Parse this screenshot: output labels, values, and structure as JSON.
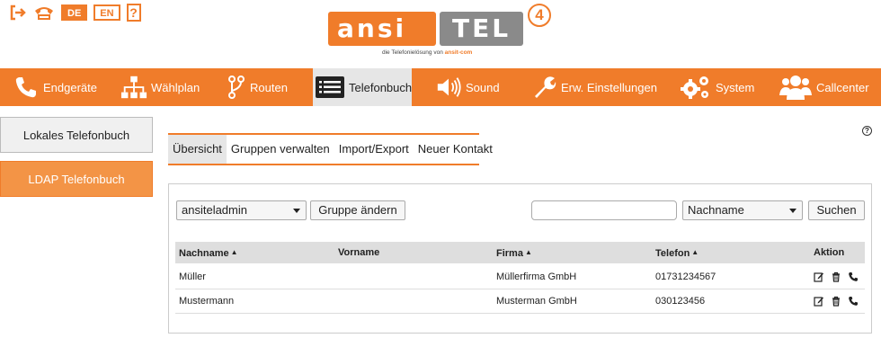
{
  "top_bar": {
    "logout_icon": "logout-icon",
    "phone_icon": "phone-hangup-icon",
    "lang_de": "DE",
    "lang_en": "EN",
    "help": "?"
  },
  "logo": {
    "part1": "ansi",
    "part2": "TEL",
    "version": "4",
    "tagline": "die Telefonielösung von",
    "tagline_brand": "ansit-com"
  },
  "main_nav": [
    {
      "label": "Endgeräte",
      "icon": "phone-icon"
    },
    {
      "label": "Wählplan",
      "icon": "sitemap-icon"
    },
    {
      "label": "Routen",
      "icon": "route-icon"
    },
    {
      "label": "Telefonbuch",
      "icon": "list-icon",
      "active": true
    },
    {
      "label": "Sound",
      "icon": "speaker-icon"
    },
    {
      "label": "Erw. Einstellungen",
      "icon": "wrench-icon"
    },
    {
      "label": "System",
      "icon": "gears-icon"
    },
    {
      "label": "Callcenter",
      "icon": "users-icon"
    }
  ],
  "sidebar": {
    "local": "Lokales Telefonbuch",
    "ldap": "LDAP Telefonbuch"
  },
  "sub_tabs": [
    "Übersicht",
    "Gruppen verwalten",
    "Import/Export",
    "Neuer Kontakt"
  ],
  "toolbar": {
    "group_select": "ansiteladmin",
    "group_button": "Gruppe ändern",
    "search_value": "",
    "search_field_select": "Nachname",
    "search_button": "Suchen"
  },
  "table": {
    "headers": {
      "nachname": "Nachname",
      "vorname": "Vorname",
      "firma": "Firma",
      "telefon": "Telefon",
      "aktion": "Aktion"
    },
    "rows": [
      {
        "nachname": "Müller",
        "vorname": "",
        "firma": "Müllerfirma GmbH",
        "telefon": "01731234567"
      },
      {
        "nachname": "Mustermann",
        "vorname": "",
        "firma": "Musterman GmbH",
        "telefon": "030123456"
      }
    ]
  },
  "colors": {
    "accent": "#f07c2a",
    "nav_active_bg": "#e6e6e6",
    "sidebar_active": "#f39446"
  }
}
